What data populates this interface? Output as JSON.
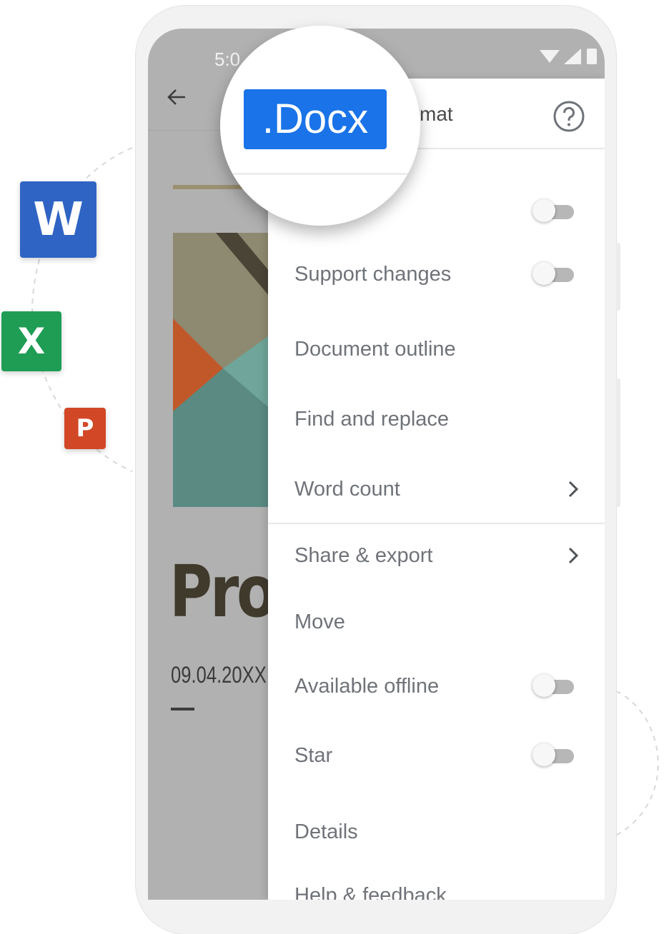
{
  "badges": {
    "word": "W",
    "excel": "X",
    "powerpoint": "P"
  },
  "status_bar": {
    "time": "5:0"
  },
  "document": {
    "title": "Proj",
    "date": "09.04.20XX"
  },
  "drawer": {
    "header_title": "Format",
    "magnifier_label": ".Docx",
    "items": [
      {
        "label": "",
        "control": "toggle",
        "checked": false
      },
      {
        "label": "Support changes",
        "control": "toggle",
        "checked": false
      },
      {
        "label": "Document outline",
        "control": "none"
      },
      {
        "label": "Find and replace",
        "control": "none"
      },
      {
        "label": "Word count",
        "control": "chevron"
      },
      {
        "label": "Share & export",
        "control": "chevron"
      },
      {
        "label": "Move",
        "control": "none"
      },
      {
        "label": "Available offline",
        "control": "toggle",
        "checked": false
      },
      {
        "label": "Star",
        "control": "toggle",
        "checked": false
      },
      {
        "label": "Details",
        "control": "none"
      },
      {
        "label": "Help & feedback",
        "control": "none"
      }
    ]
  },
  "colors": {
    "docx_chip": "#1a73e8",
    "word": "#2f64c4",
    "excel": "#1f9d55",
    "powerpoint": "#d24726"
  }
}
